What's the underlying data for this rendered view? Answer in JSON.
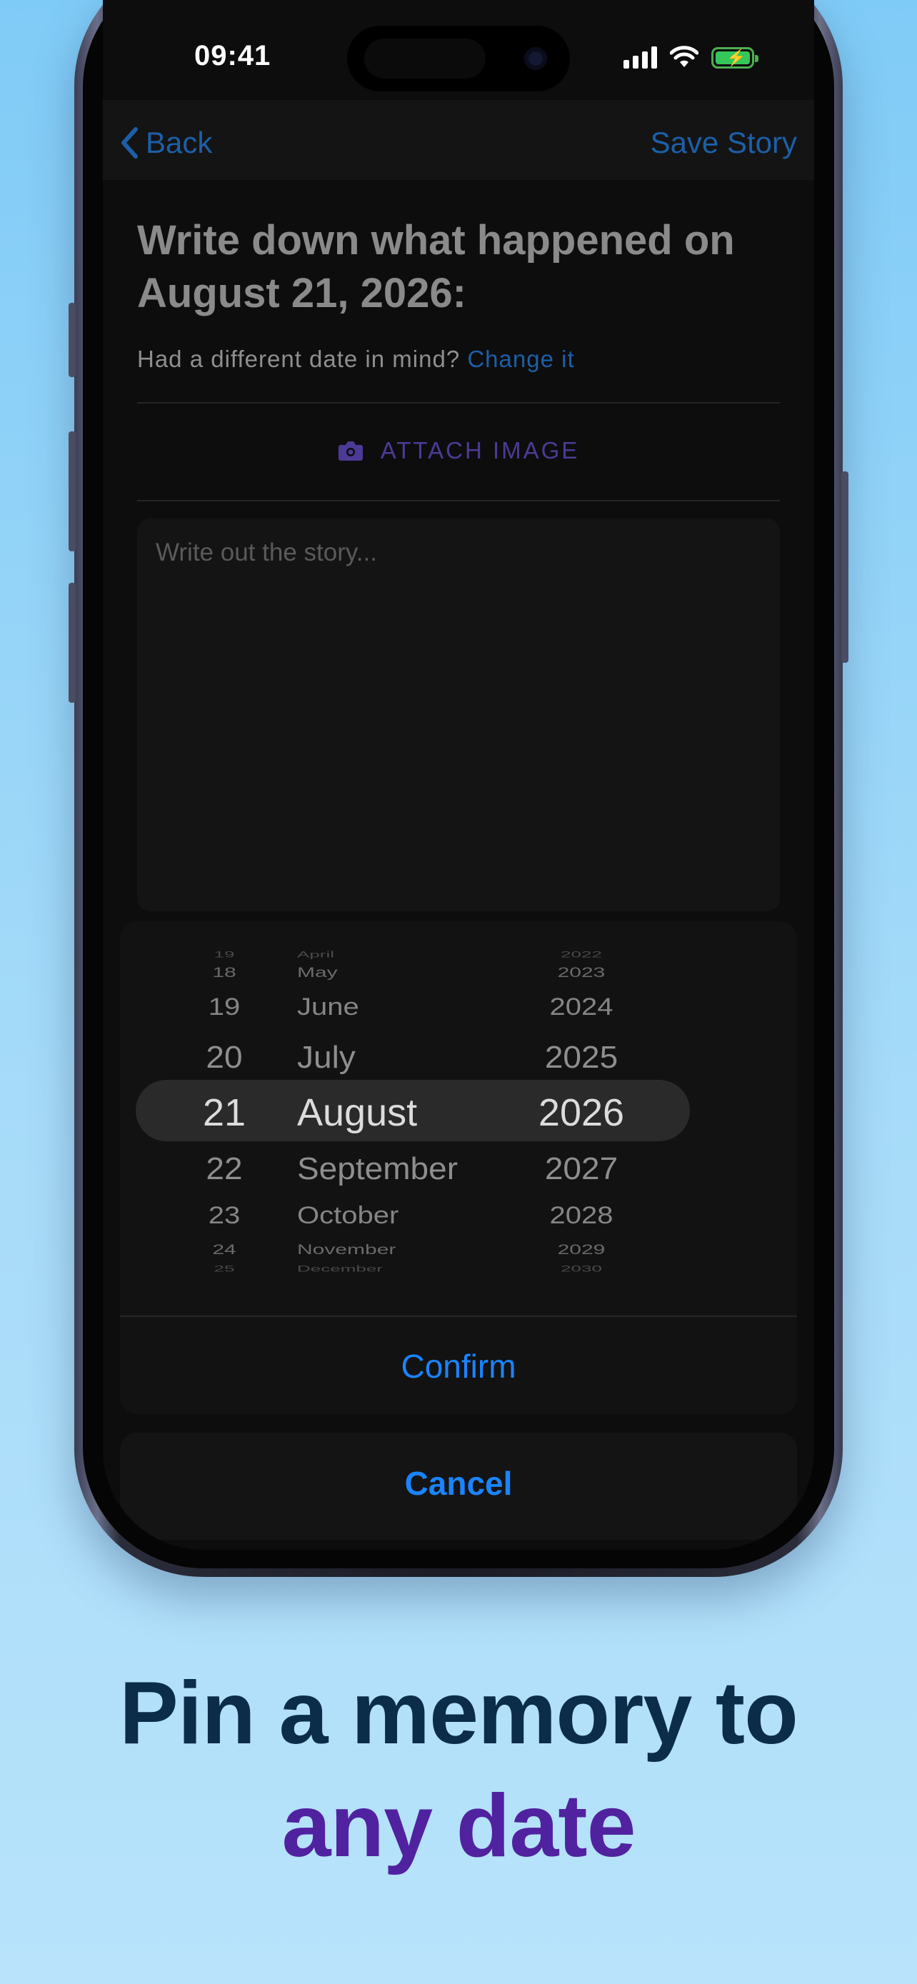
{
  "status_bar": {
    "time": "09:41"
  },
  "nav": {
    "back_label": "Back",
    "save_label": "Save Story"
  },
  "prompt": {
    "heading": "Write down what happened on August 21, 2026:",
    "subline_text": "Had a different date in mind?",
    "change_link": "Change it"
  },
  "attach": {
    "label": "ATTACH IMAGE"
  },
  "story": {
    "placeholder": "Write out the story..."
  },
  "date_picker": {
    "days": [
      "19",
      "18",
      "19",
      "20",
      "21",
      "22",
      "23",
      "24",
      "25"
    ],
    "months": [
      "April",
      "May",
      "June",
      "July",
      "August",
      "September",
      "October",
      "November",
      "December"
    ],
    "years": [
      "2022",
      "2023",
      "2024",
      "2025",
      "2026",
      "2027",
      "2028",
      "2029",
      "2030"
    ],
    "selected": {
      "day": "21",
      "month": "August",
      "year": "2026"
    },
    "confirm_label": "Confirm",
    "cancel_label": "Cancel"
  },
  "caption": {
    "line1": "Pin a memory to",
    "line2": "any date"
  },
  "colors": {
    "accent_blue": "#1a84ff",
    "link_blue": "#1c5fa8",
    "caption_purple": "#5022a0",
    "caption_navy": "#0c2d4a"
  }
}
